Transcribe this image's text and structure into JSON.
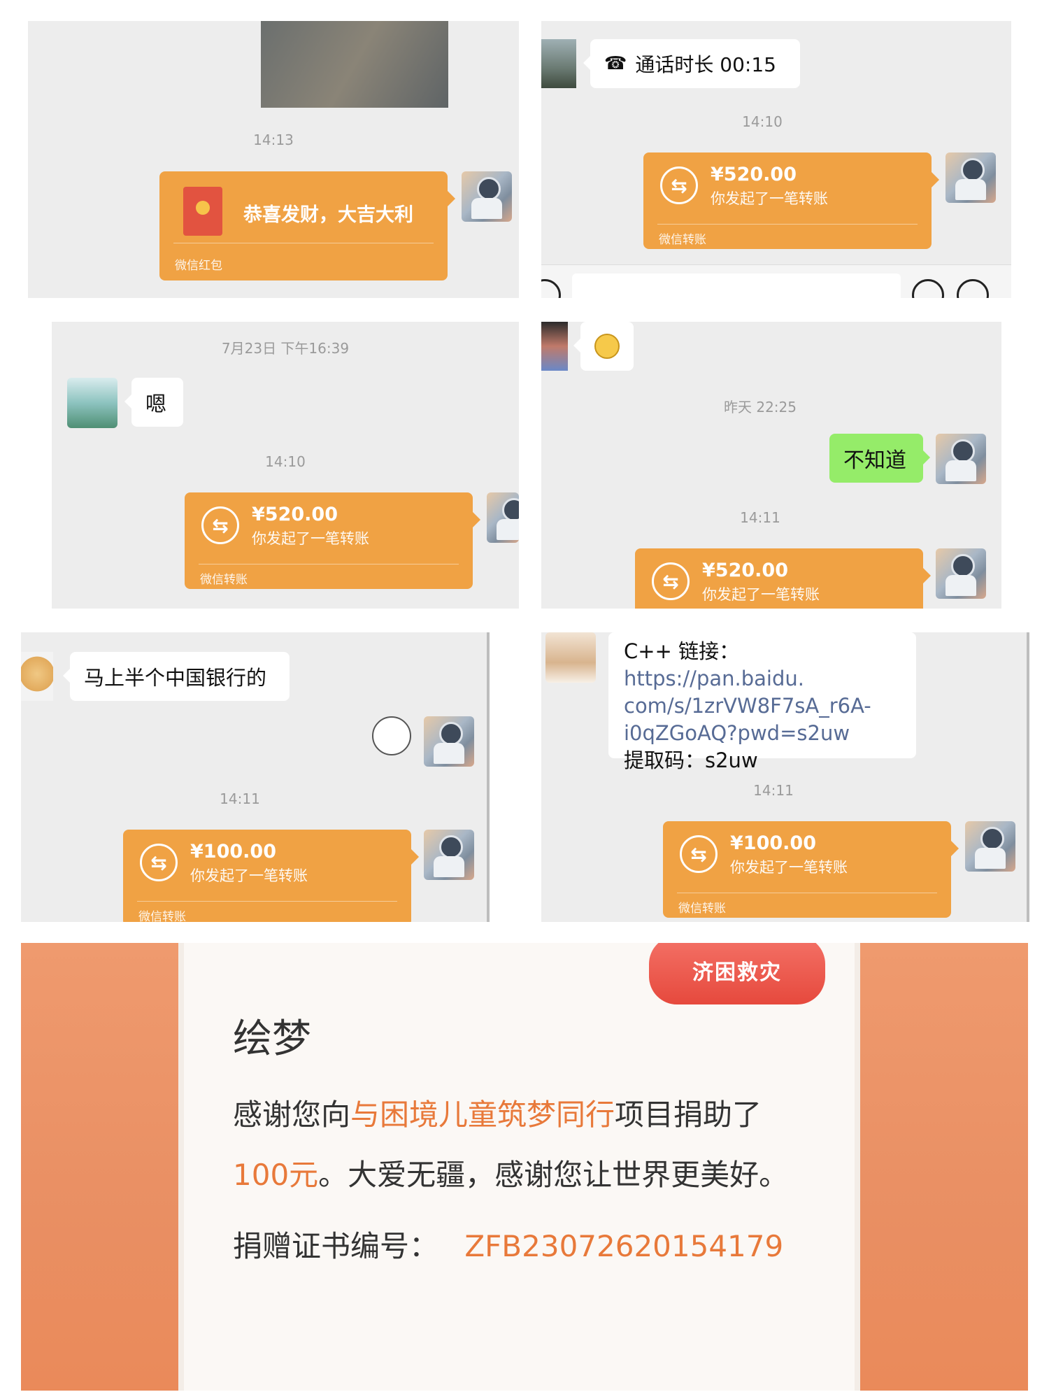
{
  "panel1": {
    "time": "14:13",
    "red_packet": {
      "text": "恭喜发财，大吉大利",
      "footer": "微信红包"
    }
  },
  "panel2": {
    "call": {
      "label": "通话时长 00:15"
    },
    "time": "14:10",
    "transfer": {
      "amount": "¥520.00",
      "desc": "你发起了一笔转账",
      "footer": "微信转账"
    }
  },
  "panel3": {
    "date": "7月23日 下午16:39",
    "msg": "嗯",
    "time": "14:10",
    "transfer": {
      "amount": "¥520.00",
      "desc": "你发起了一笔转账",
      "footer": "微信转账"
    }
  },
  "panel4": {
    "date": "昨天 22:25",
    "msg_sent": "不知道",
    "time": "14:11",
    "transfer": {
      "amount": "¥520.00",
      "desc": "你发起了一笔转账"
    }
  },
  "panel5": {
    "msg": "马上半个中国银行的",
    "time": "14:11",
    "transfer": {
      "amount": "¥100.00",
      "desc": "你发起了一笔转账",
      "footer": "微信转账"
    }
  },
  "panel6": {
    "msg_label": "C++ 链接：",
    "msg_link_1": "https://pan.baidu.",
    "msg_link_2": "com/s/1zrVW8F7sA_r6A-",
    "msg_link_3": "i0qZGoAQ?pwd=s2uw",
    "msg_code": "提取码：s2uw",
    "time": "14:11",
    "transfer": {
      "amount": "¥100.00",
      "desc": "你发起了一笔转账",
      "footer": "微信转账"
    }
  },
  "certificate": {
    "badge": "济困救灾",
    "name": "绘梦",
    "line1_a": "感谢您向",
    "line1_project": "与困境儿童筑梦同行",
    "line1_b": "项目捐助了",
    "line2_amount": "100元",
    "line2_b": "。大爱无疆，感谢您让世界更美好。",
    "cert_label": "捐赠证书编号：",
    "cert_number": "ZFB23072620154179"
  }
}
